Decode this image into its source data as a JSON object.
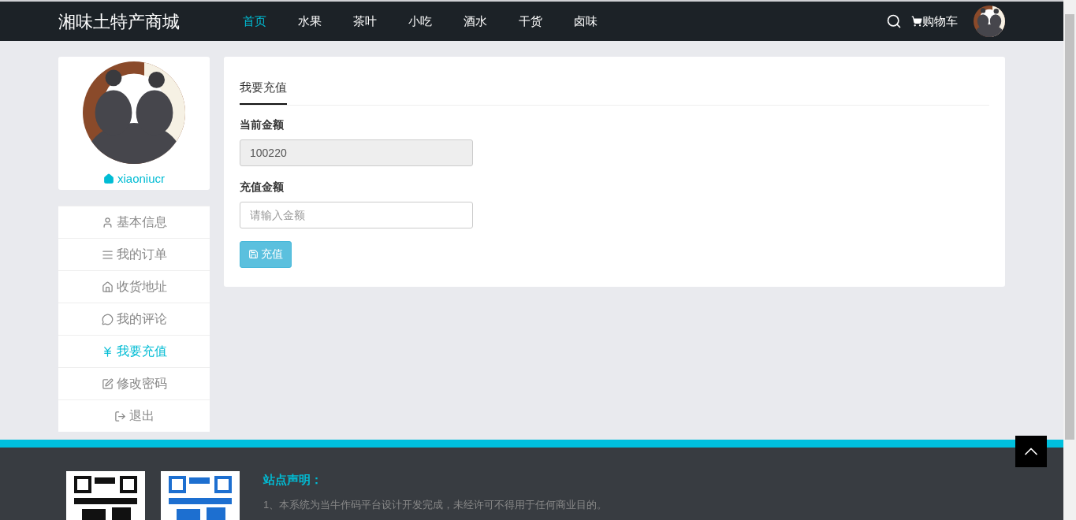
{
  "site_title": "湘味土特产商城",
  "nav": [
    {
      "label": "首页",
      "selected": true
    },
    {
      "label": "水果",
      "selected": false
    },
    {
      "label": "茶叶",
      "selected": false
    },
    {
      "label": "小吃",
      "selected": false
    },
    {
      "label": "酒水",
      "selected": false
    },
    {
      "label": "干货",
      "selected": false
    },
    {
      "label": "卤味",
      "selected": false
    }
  ],
  "cart": "购物车",
  "profile": {
    "username": "xiaoniucr"
  },
  "menu": [
    {
      "kind": "user",
      "label": "基本信息",
      "selected": false
    },
    {
      "kind": "list",
      "label": "我的订单",
      "selected": false
    },
    {
      "kind": "home",
      "label": "收货地址",
      "selected": false
    },
    {
      "kind": "comment",
      "label": "我的评论",
      "selected": false
    },
    {
      "kind": "yen",
      "label": "我要充值",
      "selected": true
    },
    {
      "kind": "edit",
      "label": "修改密码",
      "selected": false
    },
    {
      "kind": "logout",
      "label": "退出",
      "selected": false
    }
  ],
  "panel": {
    "tabs": [
      {
        "label": "我要充值",
        "selected": true
      }
    ],
    "fields": [
      {
        "label": "当前金额",
        "value": "100220",
        "disabled": true
      },
      {
        "label": "充值金额",
        "placeholder": "请输入金额",
        "disabled": false
      }
    ],
    "submit": "充值"
  },
  "footer": {
    "heading": "站点声明：",
    "lines": [
      "1、本系统为当牛作码平台设计开发完成，未经许可不得用于任何商业目的。"
    ]
  }
}
